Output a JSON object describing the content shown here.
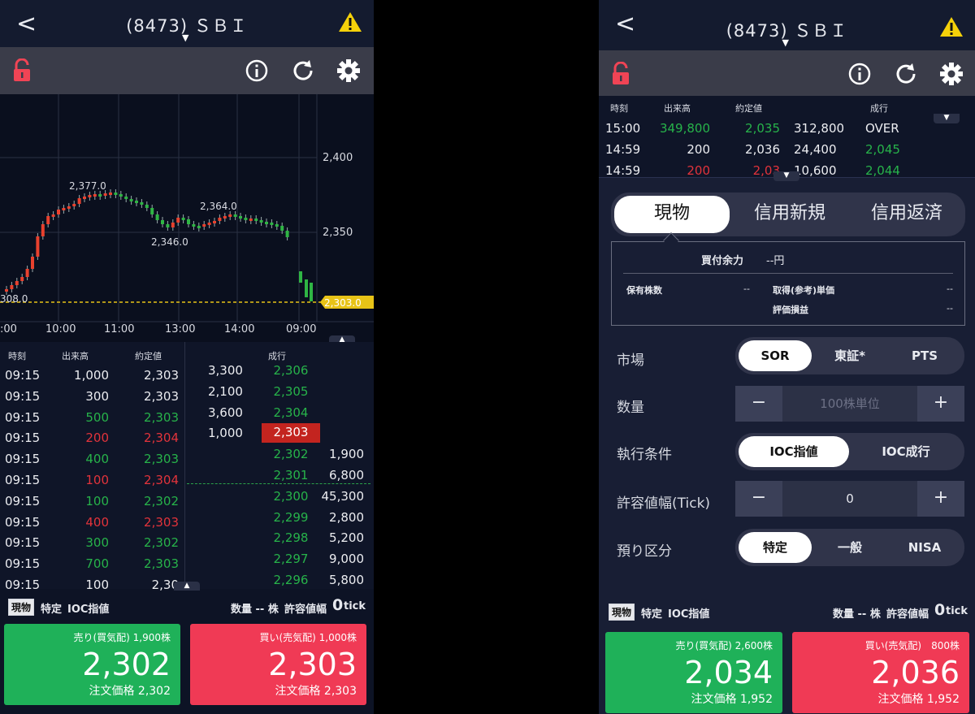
{
  "left": {
    "header": {
      "back": "<",
      "title": "(8473) ＳＢＩ"
    },
    "chart": {
      "y_ticks": [
        "2,400",
        "2,350"
      ],
      "x_ticks": [
        ":00",
        "10:00",
        "11:00",
        "13:00",
        "14:00",
        "09:00"
      ],
      "annotations": [
        "2,377.0",
        "2,364.0",
        "2,346.0",
        "308.0"
      ],
      "price_tag": "2,303.0"
    },
    "tape": {
      "headers": {
        "time": "時刻",
        "volume": "出来高",
        "price": "約定値",
        "market": "成行"
      },
      "rows": [
        {
          "time": "09:15",
          "volume": "1,000",
          "price": "2,303",
          "tone": "white"
        },
        {
          "time": "09:15",
          "volume": "300",
          "price": "2,303",
          "tone": "white"
        },
        {
          "time": "09:15",
          "volume": "500",
          "price": "2,303",
          "tone": "up"
        },
        {
          "time": "09:15",
          "volume": "200",
          "price": "2,304",
          "tone": "down"
        },
        {
          "time": "09:15",
          "volume": "400",
          "price": "2,303",
          "tone": "up"
        },
        {
          "time": "09:15",
          "volume": "100",
          "price": "2,304",
          "tone": "down"
        },
        {
          "time": "09:15",
          "volume": "100",
          "price": "2,302",
          "tone": "up"
        },
        {
          "time": "09:15",
          "volume": "400",
          "price": "2,303",
          "tone": "down"
        },
        {
          "time": "09:15",
          "volume": "300",
          "price": "2,302",
          "tone": "up"
        },
        {
          "time": "09:15",
          "volume": "700",
          "price": "2,303",
          "tone": "up"
        },
        {
          "time": "09:15",
          "volume": "100",
          "price": "2,30",
          "tone": "white"
        }
      ]
    },
    "board": [
      {
        "ask": "3,300",
        "price": "2,306",
        "bid": ""
      },
      {
        "ask": "2,100",
        "price": "2,305",
        "bid": ""
      },
      {
        "ask": "3,600",
        "price": "2,304",
        "bid": ""
      },
      {
        "ask": "1,000",
        "price": "2,303",
        "bid": ""
      },
      {
        "ask": "",
        "price": "2,302",
        "bid": "1,900"
      },
      {
        "ask": "",
        "price": "2,301",
        "bid": "6,800"
      },
      {
        "ask": "",
        "price": "2,300",
        "bid": "45,300"
      },
      {
        "ask": "",
        "price": "2,299",
        "bid": "2,800"
      },
      {
        "ask": "",
        "price": "2,298",
        "bid": "5,200"
      },
      {
        "ask": "",
        "price": "2,297",
        "bid": "9,000"
      },
      {
        "ask": "",
        "price": "2,296",
        "bid": "5,800"
      }
    ],
    "status": {
      "tag": "現物",
      "account": "特定",
      "cond": "IOC指値",
      "qty": "数量 -- 株",
      "tol_label": "許容値幅",
      "tol_value": "0",
      "tol_unit": "tick"
    },
    "sell": {
      "label": "売り(買気配) 1,900株",
      "price": "2,302",
      "order": "注文価格 2,302"
    },
    "buy": {
      "label": "買い(売気配) 1,000株",
      "price": "2,303",
      "order": "注文価格 2,303"
    }
  },
  "right": {
    "header": {
      "back": "<",
      "title": "(8473) ＳＢＩ"
    },
    "tape": {
      "headers": {
        "time": "時刻",
        "volume": "出来高",
        "price": "約定値",
        "market": "成行"
      },
      "rows": [
        {
          "time": "15:00",
          "volume": "349,800",
          "price": "2,035",
          "mvol": "312,800",
          "mlabel": "OVER"
        },
        {
          "time": "14:59",
          "volume": "200",
          "price": "2,036",
          "mvol": "24,400",
          "mlabel": "2,045"
        },
        {
          "time": "14:59",
          "volume": "200",
          "price": "2,03",
          "mvol": "10,600",
          "mlabel": "2,044"
        }
      ]
    },
    "tabs": [
      "現物",
      "信用新規",
      "信用返済"
    ],
    "info": {
      "buying_power_label": "買付余力",
      "buying_power_value": "--円",
      "holdings_label": "保有株数",
      "holdings_value": "--",
      "cost_label": "取得(参考)単価",
      "cost_value": "--",
      "pl_label": "評価損益",
      "pl_value": "--"
    },
    "form": {
      "market_label": "市場",
      "market_options": [
        "SOR",
        "東証*",
        "PTS"
      ],
      "qty_label": "数量",
      "qty_placeholder": "100株単位",
      "cond_label": "執行条件",
      "cond_options": [
        "IOC指値",
        "IOC成行"
      ],
      "tol_label": "許容値幅(Tick)",
      "tol_value": "0",
      "acct_label": "預り区分",
      "acct_options": [
        "特定",
        "一般",
        "NISA"
      ],
      "minus": "−",
      "plus": "+"
    },
    "status": {
      "tag": "現物",
      "account": "特定",
      "cond": "IOC指値",
      "qty": "数量 -- 株",
      "tol_label": "許容値幅",
      "tol_value": "0",
      "tol_unit": "tick"
    },
    "sell": {
      "label": "売り(買気配) 2,600株",
      "price": "2,034",
      "order": "注文価格 1,952"
    },
    "buy": {
      "label": "買い(売気配)　800株",
      "price": "2,036",
      "order": "注文価格 1,952"
    }
  }
}
